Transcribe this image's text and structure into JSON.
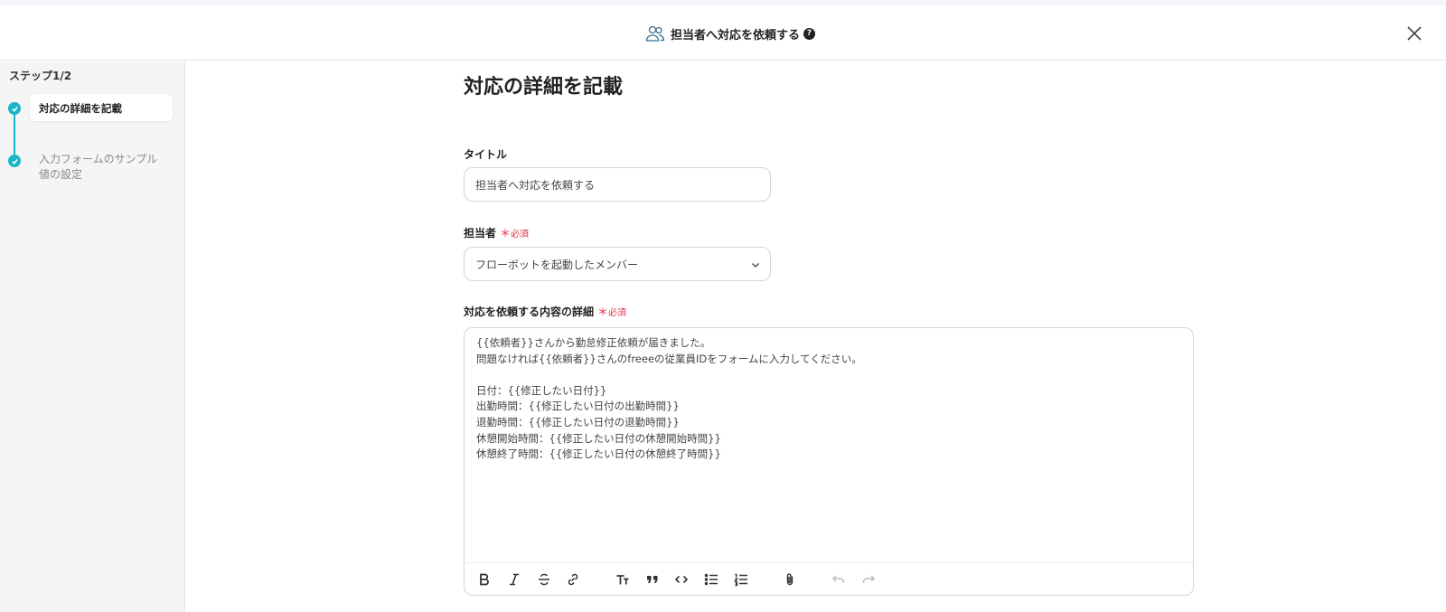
{
  "header": {
    "title": "担当者へ対応を依頼する",
    "help_icon": "question-circle-icon",
    "close_icon": "close-icon"
  },
  "sidebar": {
    "step_count": "ステップ1/2",
    "steps": [
      {
        "label": "対応の詳細を記載",
        "state": "active"
      },
      {
        "label": "入力フォームのサンプル値の設定",
        "state": "done"
      }
    ],
    "accent_color": "#1ab5c6"
  },
  "main": {
    "page_title": "対応の詳細を記載",
    "title_field": {
      "label": "タイトル",
      "value": "担当者へ対応を依頼する"
    },
    "assignee_field": {
      "label": "担当者",
      "required_star": "＊",
      "required_text": "必須",
      "selected": "フローボットを起動したメンバー"
    },
    "detail_field": {
      "label": "対応を依頼する内容の詳細",
      "required_star": "＊",
      "required_text": "必須",
      "value": "{{依頼者}}さんから勤怠修正依頼が届きました。\n問題なければ{{依頼者}}さんのfreeeの従業員IDをフォームに入力してください。\n\n日付：{{修正したい日付}}\n出勤時間：{{修正したい日付の出勤時間}}\n退勤時間：{{修正したい日付の退勤時間}}\n休憩開始時間：{{修正したい日付の休憩開始時間}}\n休憩終了時間：{{修正したい日付の休憩終了時間}}"
    },
    "toolbar": [
      "bold-icon",
      "italic-icon",
      "strikethrough-icon",
      "link-icon",
      "text-size-icon",
      "quote-icon",
      "code-icon",
      "bullet-list-icon",
      "numbered-list-icon",
      "attachment-icon",
      "undo-icon",
      "redo-icon"
    ]
  }
}
